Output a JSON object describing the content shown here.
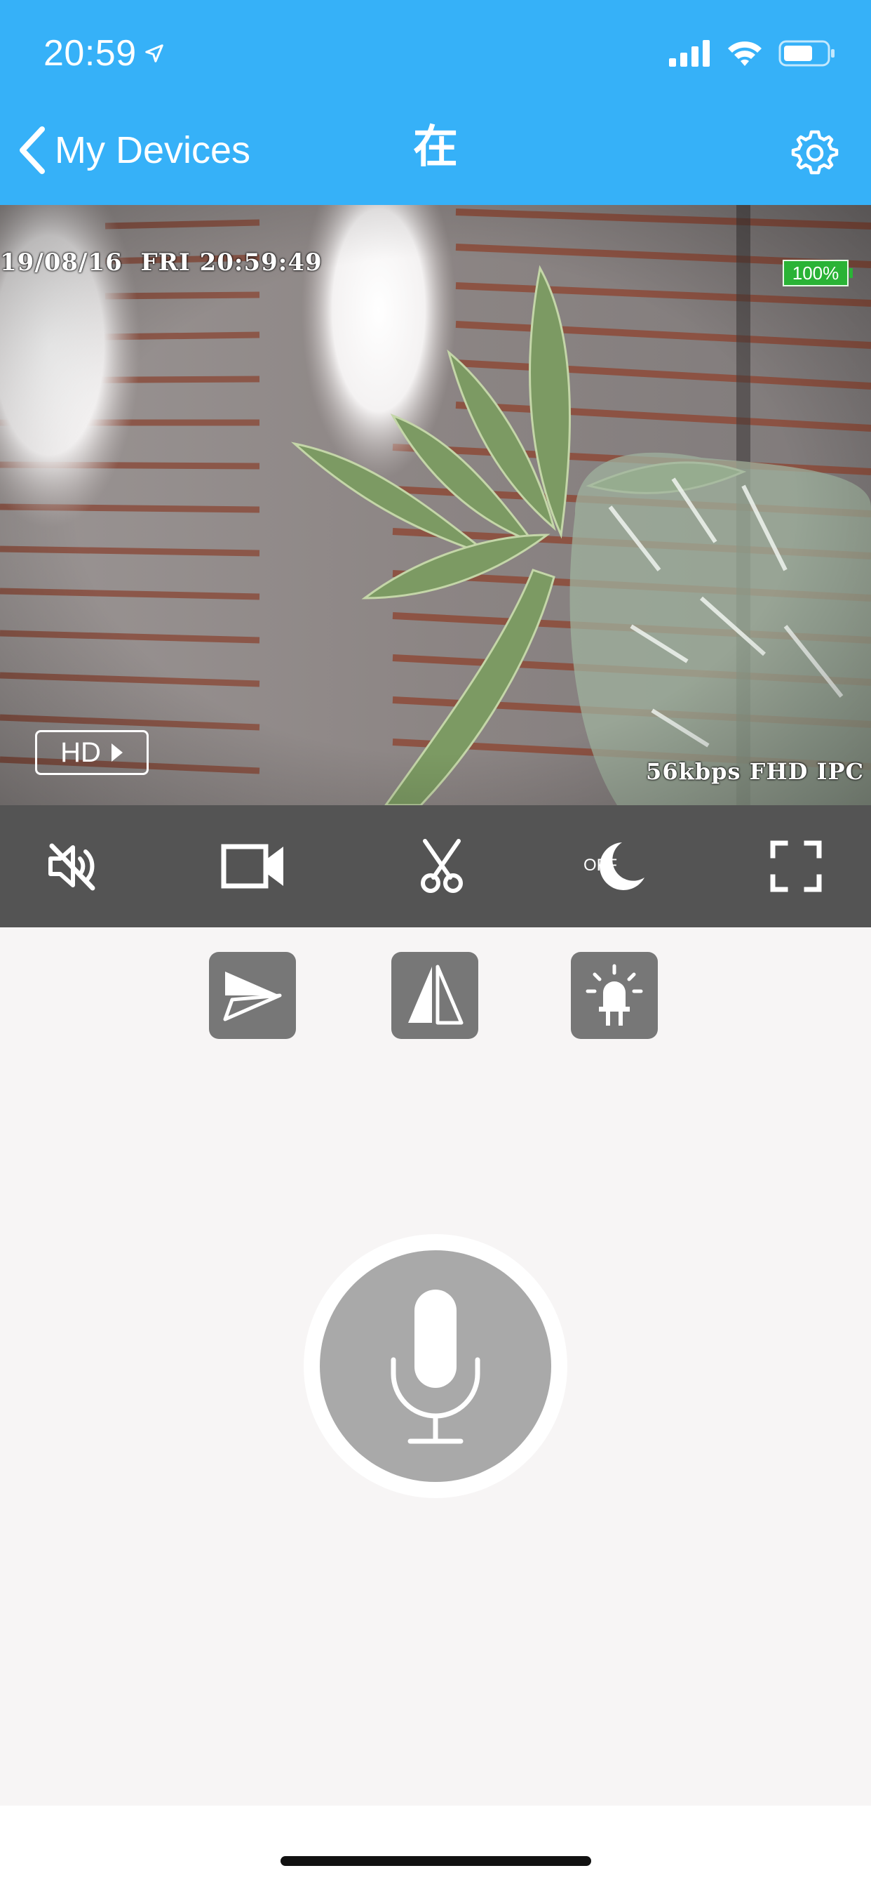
{
  "status_bar": {
    "time": "20:59",
    "location_icon": "location-arrow-icon",
    "signal_icon": "cellular-signal-icon",
    "wifi_icon": "wifi-icon",
    "battery_icon": "battery-icon"
  },
  "nav": {
    "back_label": "My Devices",
    "title": "在",
    "settings_icon": "gear-icon"
  },
  "video": {
    "timestamp": "19/08/16  FRI 20:59:49",
    "battery_percent": "100%",
    "quality_label": "HD",
    "bitrate_info": "56kbps FHD IPC"
  },
  "controls": {
    "mute_icon": "speaker-muted-icon",
    "record_icon": "video-camera-icon",
    "snapshot_icon": "scissors-icon",
    "night_mode_label": "OFF",
    "night_mode_icon": "moon-icon",
    "fullscreen_icon": "fullscreen-icon"
  },
  "secondary_controls": {
    "flip_vertical_icon": "flip-vertical-icon",
    "mirror_icon": "mirror-icon",
    "light_icon": "led-light-icon"
  },
  "talk": {
    "mic_icon": "microphone-icon"
  },
  "colors": {
    "header": "#36b1f8",
    "control_bar": "#545454",
    "button_gray": "#777777",
    "mic_gray": "#a9a9a9",
    "battery_green": "#2ab336",
    "background": "#f7f5f5"
  }
}
